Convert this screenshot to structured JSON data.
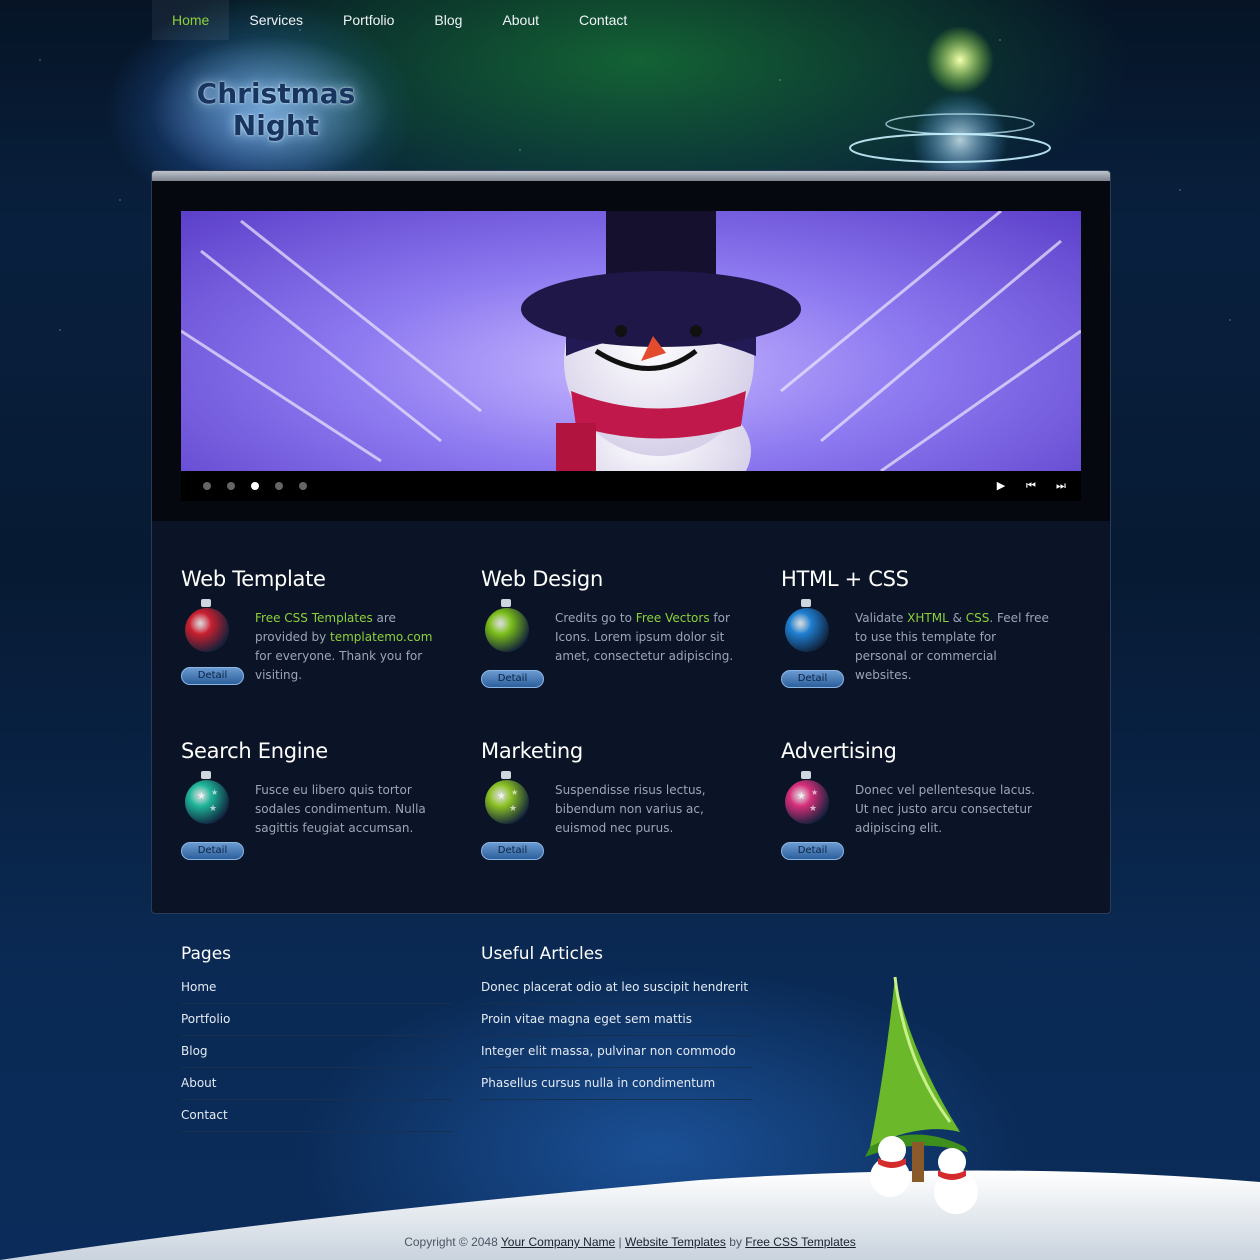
{
  "nav": {
    "items": [
      {
        "label": "Home",
        "active": true
      },
      {
        "label": "Services"
      },
      {
        "label": "Portfolio"
      },
      {
        "label": "Blog"
      },
      {
        "label": "About"
      },
      {
        "label": "Contact"
      }
    ]
  },
  "logo": {
    "line1": "Christmas",
    "line2": "Night"
  },
  "slider": {
    "image": "snowman-photo",
    "dots": 5,
    "active_dot": 3,
    "controls": [
      "play-icon",
      "previous-icon",
      "next-icon"
    ]
  },
  "services": [
    {
      "title": "Web Template",
      "ornament_color": "#c9202f",
      "ornament": "red-ornament-icon",
      "desc_parts": [
        {
          "t": "Free CSS Templates",
          "hl": true
        },
        {
          "t": " are provided by "
        },
        {
          "t": "templatemo.com",
          "hl": true
        },
        {
          "t": " for everyone. Thank you for visiting."
        }
      ],
      "button": "Detail"
    },
    {
      "title": "Web Design",
      "ornament_color": "#7cbf1a",
      "ornament": "green-ornament-icon",
      "desc_parts": [
        {
          "t": "Credits go to "
        },
        {
          "t": "Free Vectors",
          "hl": true
        },
        {
          "t": " for Icons. Lorem ipsum dolor sit amet, consectetur adipiscing."
        }
      ],
      "button": "Detail"
    },
    {
      "title": "HTML + CSS",
      "ornament_color": "#1f7fd0",
      "ornament": "blue-ornament-icon",
      "desc_parts": [
        {
          "t": "Validate "
        },
        {
          "t": "XHTML",
          "hl": true
        },
        {
          "t": " & "
        },
        {
          "t": "CSS",
          "hl": true
        },
        {
          "t": ". Feel free to use this template for personal or commercial websites."
        }
      ],
      "button": "Detail"
    },
    {
      "title": "Search Engine",
      "ornament_color": "#1fb59a",
      "ornament": "teal-star-ornament-icon",
      "desc_parts": [
        {
          "t": "Fusce eu libero quis tortor sodales condimentum. Nulla sagittis feugiat accumsan."
        }
      ],
      "button": "Detail"
    },
    {
      "title": "Marketing",
      "ornament_color": "#8cc224",
      "ornament": "green-star-ornament-icon",
      "desc_parts": [
        {
          "t": "Suspendisse risus lectus, bibendum non varius ac, euismod nec purus."
        }
      ],
      "button": "Detail"
    },
    {
      "title": "Advertising",
      "ornament_color": "#d62f7a",
      "ornament": "pink-star-ornament-icon",
      "desc_parts": [
        {
          "t": "Donec vel pellentesque lacus. Ut nec justo arcu consectetur adipiscing elit."
        }
      ],
      "button": "Detail"
    }
  ],
  "footer": {
    "pages_title": "Pages",
    "pages": [
      "Home",
      "Portfolio",
      "Blog",
      "About",
      "Contact"
    ],
    "articles_title": "Useful Articles",
    "articles": [
      "Donec placerat odio at leo suscipit hendrerit",
      "Proin vitae magna eget sem mattis",
      "Integer elit massa, pulvinar non commodo",
      "Phasellus cursus nulla in condimentum"
    ]
  },
  "copyright": {
    "prefix": "Copyright © 2048 ",
    "company": "Your Company Name",
    "sep": " | ",
    "link1": "Website Templates",
    "by": " by ",
    "link2": "Free CSS Templates"
  },
  "colors": {
    "accent": "#8dd13a",
    "background": "#071a33",
    "panel": "#0b1426"
  }
}
